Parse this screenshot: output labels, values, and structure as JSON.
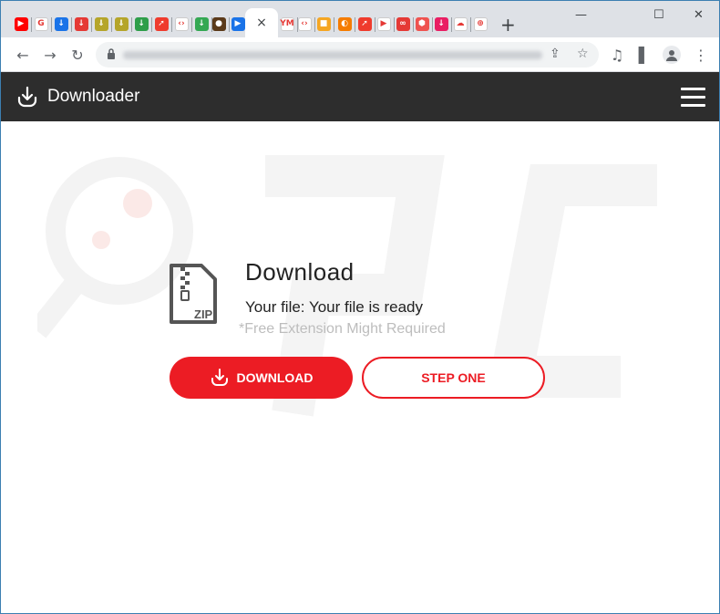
{
  "browser": {
    "tabs": [
      {
        "icon": "youtube-icon",
        "color": "#ff0000",
        "glyph": "▶"
      },
      {
        "icon": "google-icon",
        "color": "#ffffff",
        "glyph": "G"
      },
      {
        "icon": "cloud-download-icon",
        "color": "#1a73e8",
        "glyph": "↓"
      },
      {
        "icon": "download-red-icon",
        "color": "#e53935",
        "glyph": "↓"
      },
      {
        "icon": "download-olive-icon",
        "color": "#b5a52a",
        "glyph": "⇓"
      },
      {
        "icon": "download-olive-icon",
        "color": "#b5a52a",
        "glyph": "⇓"
      },
      {
        "icon": "download-green-icon",
        "color": "#2e9e49",
        "glyph": "↓"
      },
      {
        "icon": "arrow-red-icon",
        "color": "#ef3b2d",
        "glyph": "➚"
      },
      {
        "icon": "code-icon",
        "color": "#ffffff",
        "glyph": "‹›"
      },
      {
        "icon": "download-circle-green-icon",
        "color": "#34a853",
        "glyph": "↓"
      },
      {
        "icon": "record-icon",
        "color": "#5b3a1a",
        "glyph": "●"
      },
      {
        "icon": "play-icon",
        "color": "#1a73e8",
        "glyph": "▶"
      }
    ],
    "active_tab_close": "×",
    "tabs_right": [
      {
        "icon": "ym-icon",
        "color": "#ffffff",
        "glyph": "YM"
      },
      {
        "icon": "code-icon",
        "color": "#ffffff",
        "glyph": "‹›"
      },
      {
        "icon": "video-orange-icon",
        "color": "#f5a623",
        "glyph": "■"
      },
      {
        "icon": "orange-circle-icon",
        "color": "#f57c00",
        "glyph": "◐"
      },
      {
        "icon": "arrow-red-icon",
        "color": "#ef3b2d",
        "glyph": "➚"
      },
      {
        "icon": "play-store-icon",
        "color": "#ffffff",
        "glyph": "▶"
      },
      {
        "icon": "link-red-icon",
        "color": "#e53935",
        "glyph": "∞"
      },
      {
        "icon": "stop-red-icon",
        "color": "#ef5350",
        "glyph": "⬢"
      },
      {
        "icon": "download-pink-icon",
        "color": "#e91e63",
        "glyph": "↓"
      },
      {
        "icon": "cloud-red-icon",
        "color": "#ffffff",
        "glyph": "☁"
      },
      {
        "icon": "download-circle-red-icon",
        "color": "#ffffff",
        "glyph": "⊕"
      }
    ],
    "new_tab": "+",
    "window_controls": {
      "minimize": "—",
      "maximize": "☐",
      "close": "✕"
    }
  },
  "toolbar": {
    "back": "←",
    "forward": "→",
    "reload": "↻",
    "share": "⇪",
    "bookmark": "☆",
    "media": "♫",
    "sidepanel": "▌",
    "profile": "●",
    "menu": "⋮"
  },
  "site": {
    "brand": "Downloader",
    "title": "Download",
    "file_label": "Your file:",
    "file_value": "Your file is ready",
    "note": "*Free Extension Might Required",
    "download_button": "DOWNLOAD",
    "step_button": "STEP ONE",
    "zip_label": "ZIP"
  },
  "colors": {
    "accent": "#ec1c24",
    "header_bg": "#2d2d2d"
  }
}
